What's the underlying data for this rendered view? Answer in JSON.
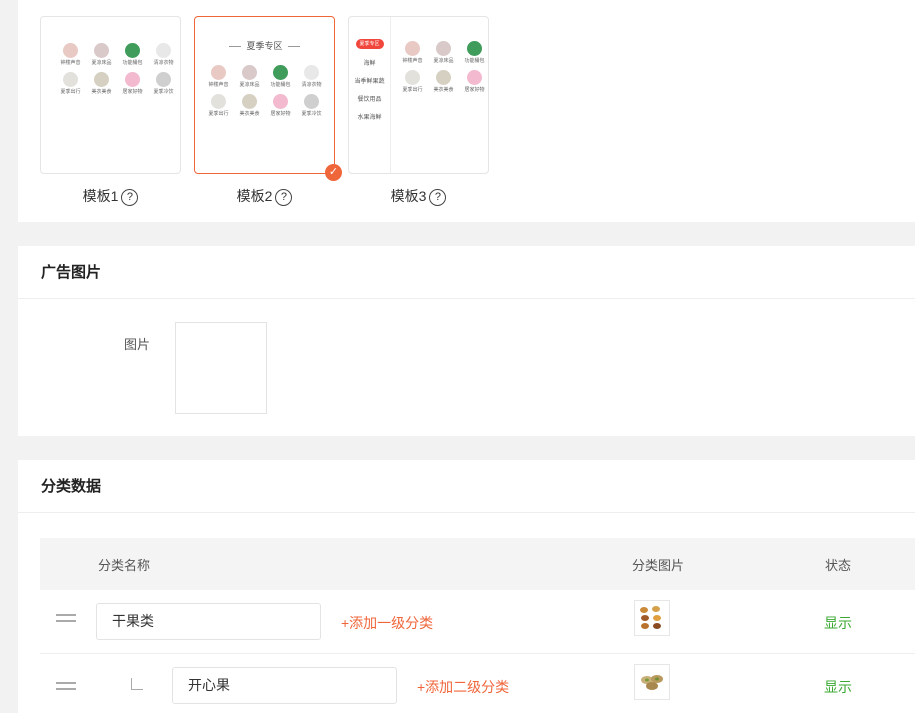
{
  "templates": [
    {
      "label": "模板1",
      "help": "?",
      "selected": false
    },
    {
      "label": "模板2",
      "help": "?",
      "selected": true,
      "header": "夏季专区"
    },
    {
      "label": "模板3",
      "help": "?",
      "selected": false,
      "sidebar": [
        "夏季专区",
        "海鲜",
        "当季鲜果蔬",
        "餐饮用品",
        "水果海鲜"
      ]
    }
  ],
  "grid_items": [
    {
      "label": "钟楼声音",
      "color": "#e9c9c4"
    },
    {
      "label": "夏凉床品",
      "color": "#d9c9c9"
    },
    {
      "label": "功能桶包",
      "color": "#3f9c5a"
    },
    {
      "label": "清凉衣物",
      "color": "#e8e8e8"
    },
    {
      "label": "夏季出行",
      "color": "#e3e1dc"
    },
    {
      "label": "美衣美食",
      "color": "#d6d0c2"
    },
    {
      "label": "居家好物",
      "color": "#f2b9cf"
    },
    {
      "label": "夏季冷饮",
      "color": "#cfcfcf"
    }
  ],
  "ad_section": {
    "title": "广告图片",
    "image_label": "图片"
  },
  "category_section": {
    "title": "分类数据",
    "columns": {
      "name": "分类名称",
      "image": "分类图片",
      "status": "状态"
    },
    "rows": [
      {
        "name": "干果类",
        "action": "+添加一级分类",
        "status": "显示",
        "level": 1
      },
      {
        "name": "开心果",
        "action": "+添加二级分类",
        "status": "显示",
        "level": 2
      }
    ]
  },
  "colors": {
    "accent": "#f0663b",
    "status_green": "#3aa832"
  },
  "check_icon": "✓"
}
